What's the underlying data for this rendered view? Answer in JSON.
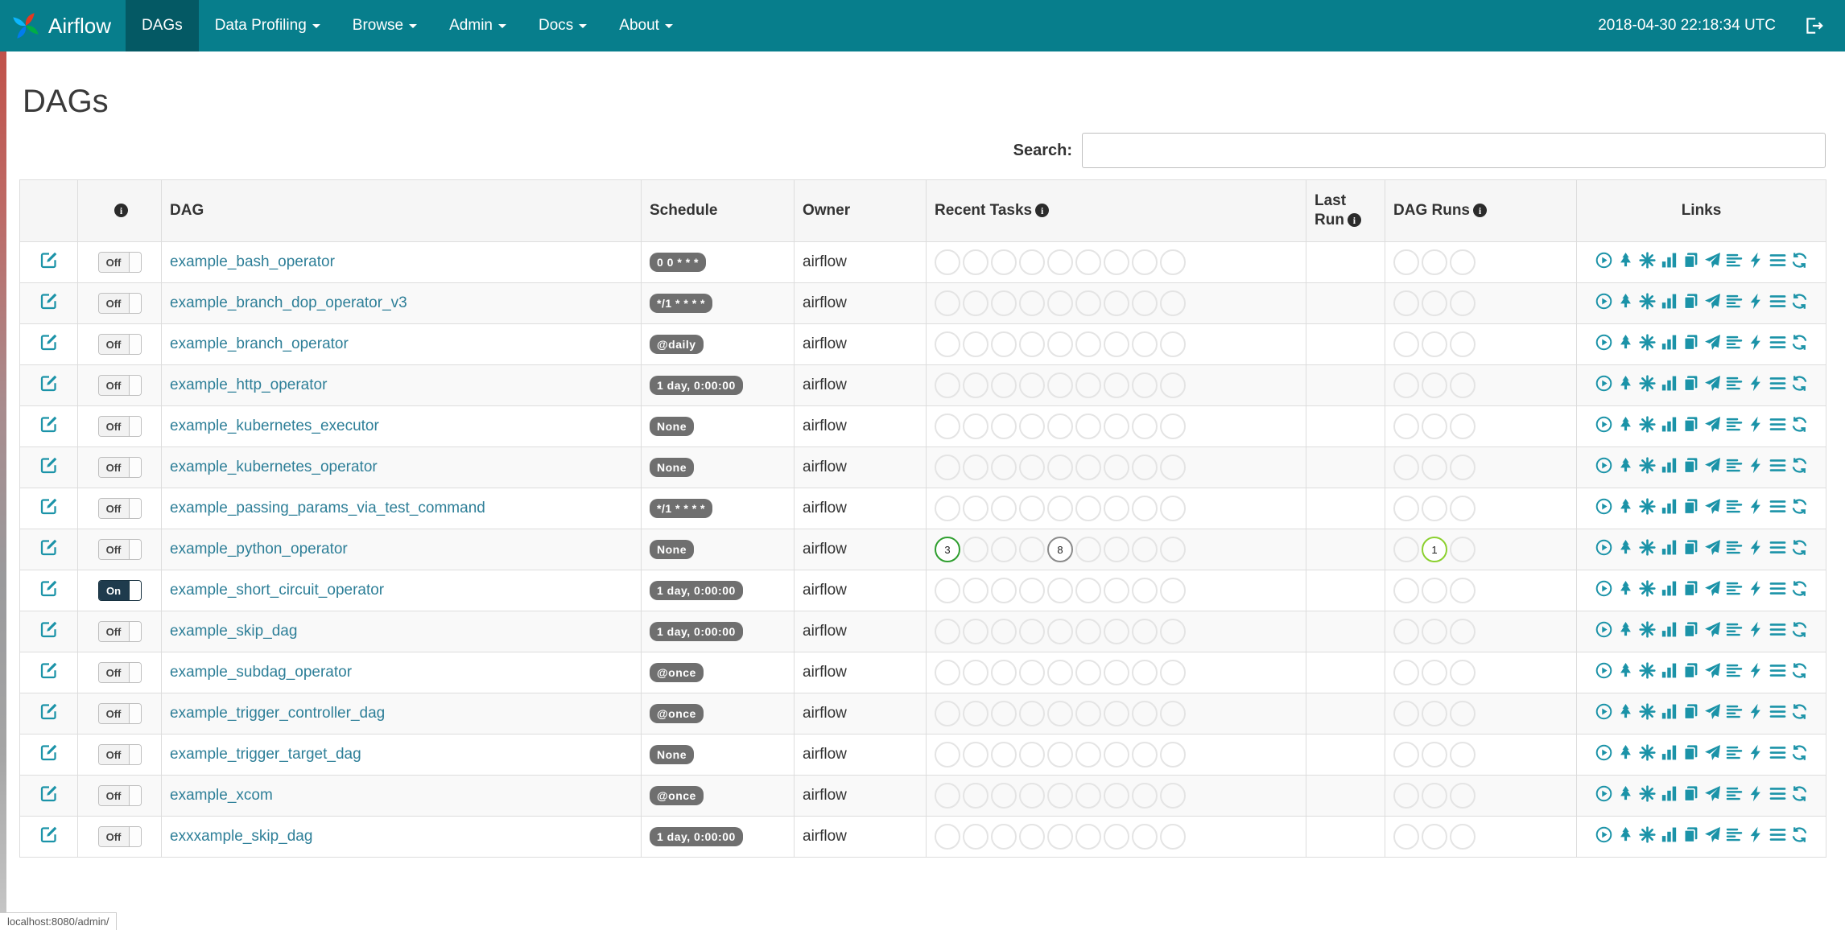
{
  "navbar": {
    "brand": "Airflow",
    "items": [
      {
        "label": "DAGs",
        "active": true,
        "dropdown": false
      },
      {
        "label": "Data Profiling",
        "dropdown": true
      },
      {
        "label": "Browse",
        "dropdown": true
      },
      {
        "label": "Admin",
        "dropdown": true
      },
      {
        "label": "Docs",
        "dropdown": true
      },
      {
        "label": "About",
        "dropdown": true
      }
    ],
    "clock": "2018-04-30 22:18:34 UTC"
  },
  "page": {
    "title": "DAGs"
  },
  "search": {
    "label": "Search:",
    "value": ""
  },
  "table": {
    "headers": {
      "dag": "DAG",
      "schedule": "Schedule",
      "owner": "Owner",
      "recent_tasks": "Recent Tasks",
      "last_run": "Last Run",
      "dag_runs": "DAG Runs",
      "links": "Links"
    },
    "toggle_on_label": "On",
    "toggle_off_label": "Off",
    "recent_task_slots": 9,
    "dag_run_slots": 3,
    "links_icons": [
      "trigger-dag",
      "tree-view",
      "graph-view",
      "task-duration",
      "task-tries",
      "landing-times",
      "gantt-view",
      "code-view",
      "task-details",
      "refresh"
    ],
    "status_colors": {
      "success": "#2e9e2e",
      "none": "#8a8a8a",
      "running": "#8bd02e"
    },
    "rows": [
      {
        "name": "example_bash_operator",
        "schedule": "0 0 * * *",
        "owner": "airflow",
        "toggle": "Off",
        "recent_tasks": [],
        "dag_runs": []
      },
      {
        "name": "example_branch_dop_operator_v3",
        "schedule": "*/1 * * * *",
        "owner": "airflow",
        "toggle": "Off",
        "recent_tasks": [],
        "dag_runs": []
      },
      {
        "name": "example_branch_operator",
        "schedule": "@daily",
        "owner": "airflow",
        "toggle": "Off",
        "recent_tasks": [],
        "dag_runs": []
      },
      {
        "name": "example_http_operator",
        "schedule": "1 day, 0:00:00",
        "owner": "airflow",
        "toggle": "Off",
        "recent_tasks": [],
        "dag_runs": []
      },
      {
        "name": "example_kubernetes_executor",
        "schedule": "None",
        "owner": "airflow",
        "toggle": "Off",
        "recent_tasks": [],
        "dag_runs": []
      },
      {
        "name": "example_kubernetes_operator",
        "schedule": "None",
        "owner": "airflow",
        "toggle": "Off",
        "recent_tasks": [],
        "dag_runs": []
      },
      {
        "name": "example_passing_params_via_test_command",
        "schedule": "*/1 * * * *",
        "owner": "airflow",
        "toggle": "Off",
        "recent_tasks": [],
        "dag_runs": []
      },
      {
        "name": "example_python_operator",
        "schedule": "None",
        "owner": "airflow",
        "toggle": "Off",
        "recent_tasks": [
          {
            "slot": 0,
            "count": 3,
            "color": "#2e9e2e"
          },
          {
            "slot": 4,
            "count": 8,
            "color": "#8a8a8a"
          }
        ],
        "dag_runs": [
          {
            "slot": 1,
            "count": 1,
            "color": "#8bd02e"
          }
        ]
      },
      {
        "name": "example_short_circuit_operator",
        "schedule": "1 day, 0:00:00",
        "owner": "airflow",
        "toggle": "On",
        "recent_tasks": [],
        "dag_runs": []
      },
      {
        "name": "example_skip_dag",
        "schedule": "1 day, 0:00:00",
        "owner": "airflow",
        "toggle": "Off",
        "recent_tasks": [],
        "dag_runs": []
      },
      {
        "name": "example_subdag_operator",
        "schedule": "@once",
        "owner": "airflow",
        "toggle": "Off",
        "recent_tasks": [],
        "dag_runs": []
      },
      {
        "name": "example_trigger_controller_dag",
        "schedule": "@once",
        "owner": "airflow",
        "toggle": "Off",
        "recent_tasks": [],
        "dag_runs": []
      },
      {
        "name": "example_trigger_target_dag",
        "schedule": "None",
        "owner": "airflow",
        "toggle": "Off",
        "recent_tasks": [],
        "dag_runs": []
      },
      {
        "name": "example_xcom",
        "schedule": "@once",
        "owner": "airflow",
        "toggle": "Off",
        "recent_tasks": [],
        "dag_runs": []
      },
      {
        "name": "exxxample_skip_dag",
        "schedule": "1 day, 0:00:00",
        "owner": "airflow",
        "toggle": "Off",
        "recent_tasks": [],
        "dag_runs": []
      }
    ]
  },
  "statusbar": {
    "text": "localhost:8080/admin/"
  }
}
